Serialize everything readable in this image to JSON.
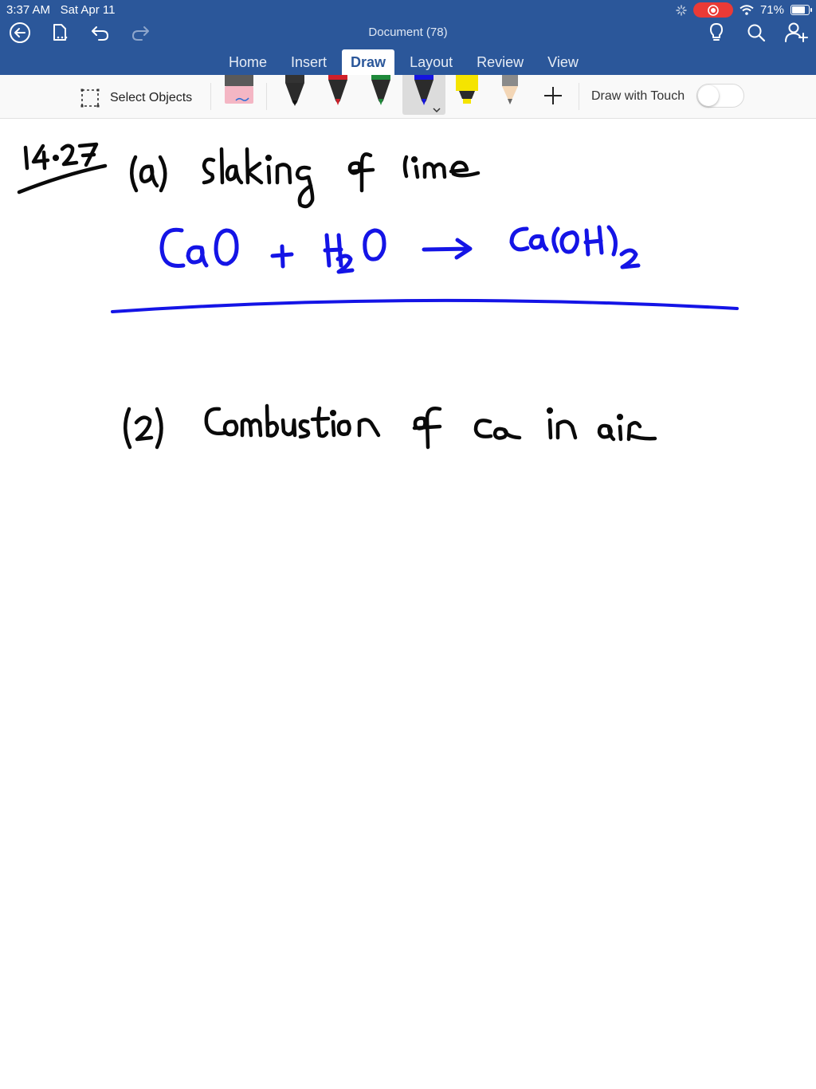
{
  "status_bar": {
    "time": "3:37 AM",
    "date": "Sat Apr 11",
    "battery": "71%",
    "battery_level": 0.71
  },
  "header": {
    "title": "Document (78)",
    "icons": [
      "back-arrow-icon",
      "file-icon",
      "undo-icon",
      "redo-icon",
      "lightbulb-icon",
      "search-icon",
      "add-person-icon"
    ]
  },
  "tabs": [
    {
      "label": "Home",
      "active": false
    },
    {
      "label": "Insert",
      "active": false
    },
    {
      "label": "Draw",
      "active": true
    },
    {
      "label": "Layout",
      "active": false
    },
    {
      "label": "Review",
      "active": false
    },
    {
      "label": "View",
      "active": false
    }
  ],
  "ribbon": {
    "select_objects": "Select Objects",
    "draw_with_touch": "Draw with Touch",
    "draw_with_touch_on": false,
    "tools": [
      {
        "name": "eraser",
        "color": "#f4b6c4"
      },
      {
        "name": "pen-black",
        "color": "#222222"
      },
      {
        "name": "pen-red",
        "color": "#d0202a"
      },
      {
        "name": "pen-green",
        "color": "#1f8a3b"
      },
      {
        "name": "pen-blue",
        "color": "#1515e0",
        "selected": true
      },
      {
        "name": "highlighter-yellow",
        "color": "#f5e400"
      },
      {
        "name": "pencil-gray",
        "color": "#8a8a8a"
      }
    ]
  },
  "document": {
    "ink_colors": {
      "black": "#0a0a0a",
      "blue": "#1414e6"
    },
    "handwritten": {
      "problem_number": "14·27",
      "part_a": "(a) Slaking of lime",
      "equation": "CaO + H2O → Ca(OH)2",
      "part_2": "(2) Combustion of Ca in air"
    }
  }
}
